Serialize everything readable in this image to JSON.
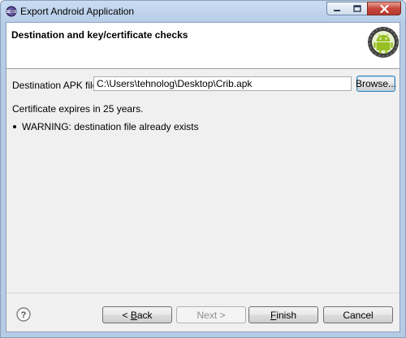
{
  "window": {
    "title": "Export Android Application",
    "icons": {
      "app": "eclipse-icon",
      "minimize": "minimize-icon",
      "maximize": "maximize-icon",
      "close": "close-icon"
    }
  },
  "banner": {
    "title": "Destination and key/certificate checks",
    "logo": "android-logo-icon"
  },
  "form": {
    "apk_label": "Destination APK file:",
    "apk_value": "C:\\Users\\tehnolog\\Desktop\\Crib.apk",
    "browse_label": "Browse..."
  },
  "messages": {
    "certificate": "Certificate expires in 25 years.",
    "warning": "WARNING: destination file already exists"
  },
  "footer": {
    "help_icon": "help-icon",
    "back_mnemonic": "< ",
    "back_underlined": "B",
    "back_rest": "ack",
    "next_label": "Next >",
    "finish_underlined": "F",
    "finish_rest": "inish",
    "cancel_label": "Cancel"
  },
  "colors": {
    "titlebar": "#b5cbe6",
    "close_button": "#c7463a",
    "android_green": "#97c024",
    "focus_border": "#3c7fb1"
  }
}
